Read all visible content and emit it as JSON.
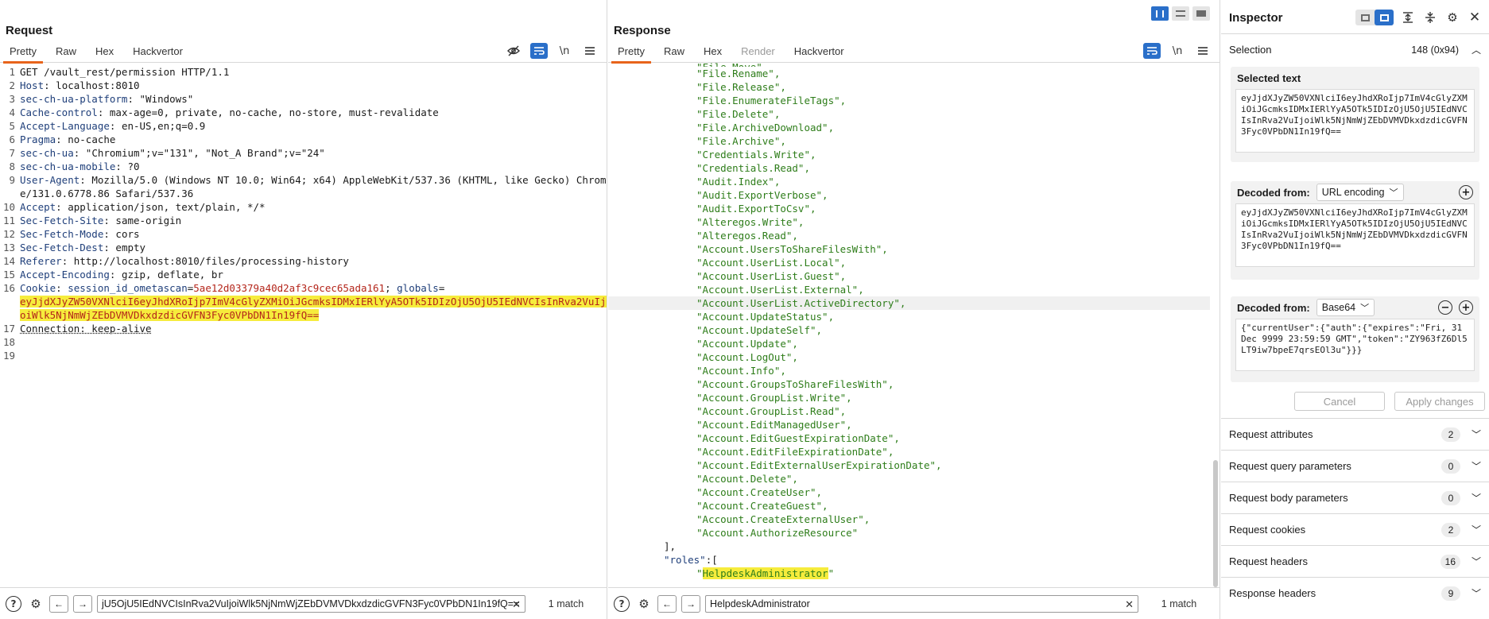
{
  "request": {
    "title": "Request",
    "tabs": [
      "Pretty",
      "Raw",
      "Hex",
      "Hackvertor"
    ],
    "active_tab": "Pretty",
    "toolbar_icons": [
      "eye-slash-icon",
      "wrap-icon",
      "newline-icon",
      "menu-icon"
    ],
    "lines": [
      {
        "n": "1",
        "text": "GET /vault_rest/permission HTTP/1.1"
      },
      {
        "n": "2",
        "name": "Host",
        "value": " localhost:8010"
      },
      {
        "n": "3",
        "name": "sec-ch-ua-platform",
        "value": " \"Windows\""
      },
      {
        "n": "4",
        "name": "Cache-control",
        "value": " max-age=0, private, no-cache, no-store, must-revalidate"
      },
      {
        "n": "5",
        "name": "Accept-Language",
        "value": " en-US,en;q=0.9"
      },
      {
        "n": "6",
        "name": "Pragma",
        "value": " no-cache"
      },
      {
        "n": "7",
        "name": "sec-ch-ua",
        "value": " \"Chromium\";v=\"131\", \"Not_A Brand\";v=\"24\""
      },
      {
        "n": "8",
        "name": "sec-ch-ua-mobile",
        "value": " ?0"
      },
      {
        "n": "9",
        "name": "User-Agent",
        "value": " Mozilla/5.0 (Windows NT 10.0; Win64; x64) AppleWebKit/537.36 (KHTML, like Gecko) Chrome/131.0.6778.86 Safari/537.36"
      },
      {
        "n": "10",
        "name": "Accept",
        "value": " application/json, text/plain, */*"
      },
      {
        "n": "11",
        "name": "Sec-Fetch-Site",
        "value": " same-origin"
      },
      {
        "n": "12",
        "name": "Sec-Fetch-Mode",
        "value": " cors"
      },
      {
        "n": "13",
        "name": "Sec-Fetch-Dest",
        "value": " empty"
      },
      {
        "n": "14",
        "name": "Referer",
        "value": " http://localhost:8010/files/processing-history"
      },
      {
        "n": "15",
        "name": "Accept-Encoding",
        "value": " gzip, deflate, br"
      }
    ],
    "cookie_line": {
      "n": "16",
      "name": "Cookie",
      "c1_name": " session_id_ometascan",
      "c1_val": "5ae12d03379a40d2af3c9cec65ada161",
      "c2_name": " globals",
      "c2_val": "eyJjdXJyZW50VXNlciI6eyJhdXRoIjp7ImV4cGlyZXMiOiJGcmksIDMxIERlYyA5OTk5IDIzOjU5OjU5IEdNVCIsInRva2VuIjoiWlk5NjNmWjZEbDVMVDkxdzdicGVFN3Fyc0VPbDN1In19fQ=="
    },
    "line17": {
      "n": "17",
      "text": "Connection: keep-alive"
    },
    "empty_lines": [
      "18",
      "19"
    ],
    "search": {
      "value": "jU5OjU5IEdNVCIsInRva2VuIjoiWlk5NjNmWjZEbDVMVDkxdzdicGVFN3Fyc0VPbDN1In19fQ==",
      "matches": "1 match"
    }
  },
  "response": {
    "title": "Response",
    "tabs": [
      "Pretty",
      "Raw",
      "Hex",
      "Render",
      "Hackvertor"
    ],
    "active_tab": "Pretty",
    "disabled_tab": "Render",
    "permissions": [
      "\"File.Rename\",",
      "\"File.Release\",",
      "\"File.EnumerateFileTags\",",
      "\"File.Delete\",",
      "\"File.ArchiveDownload\",",
      "\"File.Archive\",",
      "\"Credentials.Write\",",
      "\"Credentials.Read\",",
      "\"Audit.Index\",",
      "\"Audit.ExportVerbose\",",
      "\"Audit.ExportToCsv\",",
      "\"Alteregos.Write\",",
      "\"Alteregos.Read\",",
      "\"Account.UsersToShareFilesWith\",",
      "\"Account.UserList.Local\",",
      "\"Account.UserList.Guest\",",
      "\"Account.UserList.External\",",
      "\"Account.UserList.ActiveDirectory\",",
      "\"Account.UpdateStatus\",",
      "\"Account.UpdateSelf\",",
      "\"Account.Update\",",
      "\"Account.LogOut\",",
      "\"Account.Info\",",
      "\"Account.GroupsToShareFilesWith\",",
      "\"Account.GroupList.Write\",",
      "\"Account.GroupList.Read\",",
      "\"Account.EditManagedUser\",",
      "\"Account.EditGuestExpirationDate\",",
      "\"Account.EditFileExpirationDate\",",
      "\"Account.EditExternalUserExpirationDate\",",
      "\"Account.Delete\",",
      "\"Account.CreateUser\",",
      "\"Account.CreateGuest\",",
      "\"Account.CreateExternalUser\",",
      "\"Account.AuthorizeResource\""
    ],
    "close_bracket": "],",
    "roles_key": "\"roles\"",
    "roles_open": ":[",
    "role_value": "\"HelpdeskAdministrator\"",
    "search": {
      "value": "HelpdeskAdministrator",
      "matches": "1 match"
    }
  },
  "inspector": {
    "title": "Inspector",
    "selection_label": "Selection",
    "selection_value": "148 (0x94)",
    "selected_text_label": "Selected text",
    "selected_text": "eyJjdXJyZW50VXNlciI6eyJhdXRoIjp7ImV4cGlyZXMiOiJGcmksIDMxIERlYyA5OTk5IDIzOjU5OjU5IEdNVCIsInRva2VuIjoiWlk5NjNmWjZEbDVMVDkxdzdicGVFN3Fyc0VPbDN1In19fQ==",
    "decoded1_label": "Decoded from:",
    "decoded1_type": "URL encoding",
    "decoded1_text": "eyJjdXJyZW50VXNlciI6eyJhdXRoIjp7ImV4cGlyZXMiOiJGcmksIDMxIERlYyA5OTk5IDIzOjU5OjU5IEdNVCIsInRva2VuIjoiWlk5NjNmWjZEbDVMVDkxdzdicGVFN3Fyc0VPbDN1In19fQ==",
    "decoded2_label": "Decoded from:",
    "decoded2_type": "Base64",
    "decoded2_text": "{\"currentUser\":{\"auth\":{\"expires\":\"Fri, 31 Dec 9999 23:59:59 GMT\",\"token\":\"ZY963fZ6Dl5LT9iw7bpeE7qrsEOl3u\"}}}",
    "cancel_label": "Cancel",
    "apply_label": "Apply changes",
    "sections": [
      {
        "label": "Request attributes",
        "count": "2"
      },
      {
        "label": "Request query parameters",
        "count": "0"
      },
      {
        "label": "Request body parameters",
        "count": "0"
      },
      {
        "label": "Request cookies",
        "count": "2"
      },
      {
        "label": "Request headers",
        "count": "16"
      },
      {
        "label": "Response headers",
        "count": "9"
      }
    ]
  }
}
